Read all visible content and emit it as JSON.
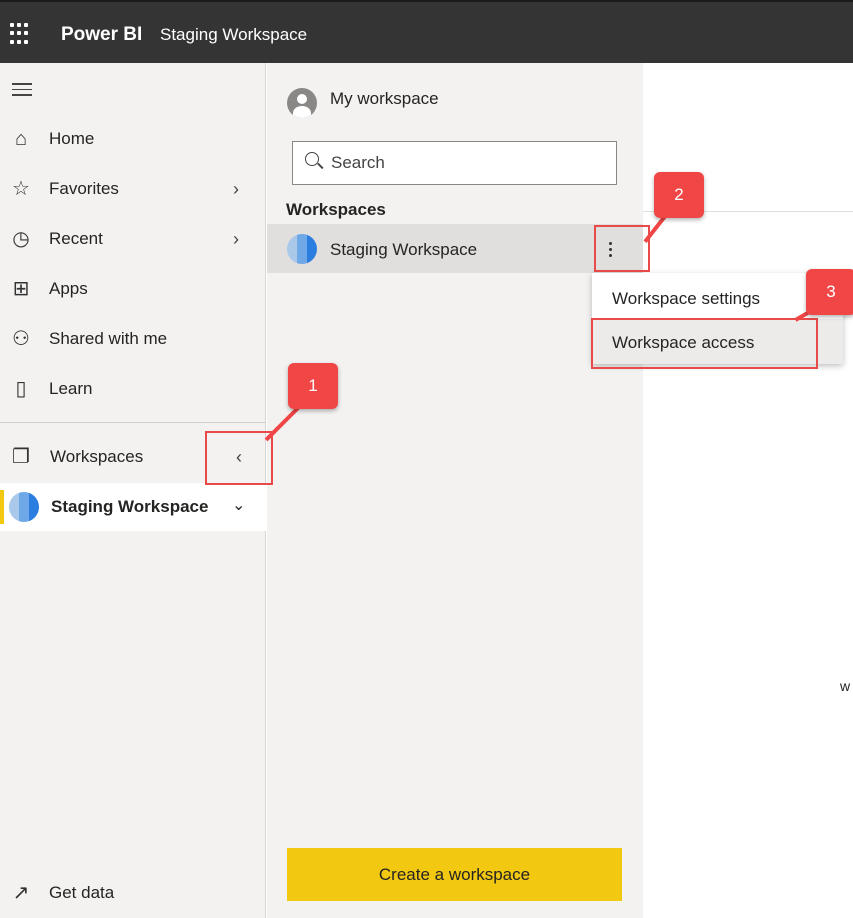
{
  "topbar": {
    "brand": "Power BI",
    "breadcrumb": "Staging Workspace"
  },
  "leftnav": {
    "items": [
      {
        "label": "Home",
        "icon": "home-icon"
      },
      {
        "label": "Favorites",
        "icon": "star-icon",
        "chevron": true
      },
      {
        "label": "Recent",
        "icon": "clock-icon",
        "chevron": true
      },
      {
        "label": "Apps",
        "icon": "apps-icon"
      },
      {
        "label": "Shared with me",
        "icon": "shared-icon"
      },
      {
        "label": "Learn",
        "icon": "book-icon"
      }
    ],
    "workspaces_label": "Workspaces",
    "active_workspace": "Staging Workspace",
    "get_data": "Get data"
  },
  "flyout": {
    "my_workspace": "My workspace",
    "search_placeholder": "Search",
    "heading": "Workspaces",
    "workspace_name": "Staging Workspace",
    "create_button": "Create a workspace"
  },
  "context_menu": {
    "items": [
      "Workspace settings",
      "Workspace access"
    ],
    "highlighted": "Workspace access"
  },
  "main": {
    "partial_text": "w"
  },
  "annotations": {
    "badges": [
      "1",
      "2",
      "3"
    ],
    "color": "#f04646"
  }
}
